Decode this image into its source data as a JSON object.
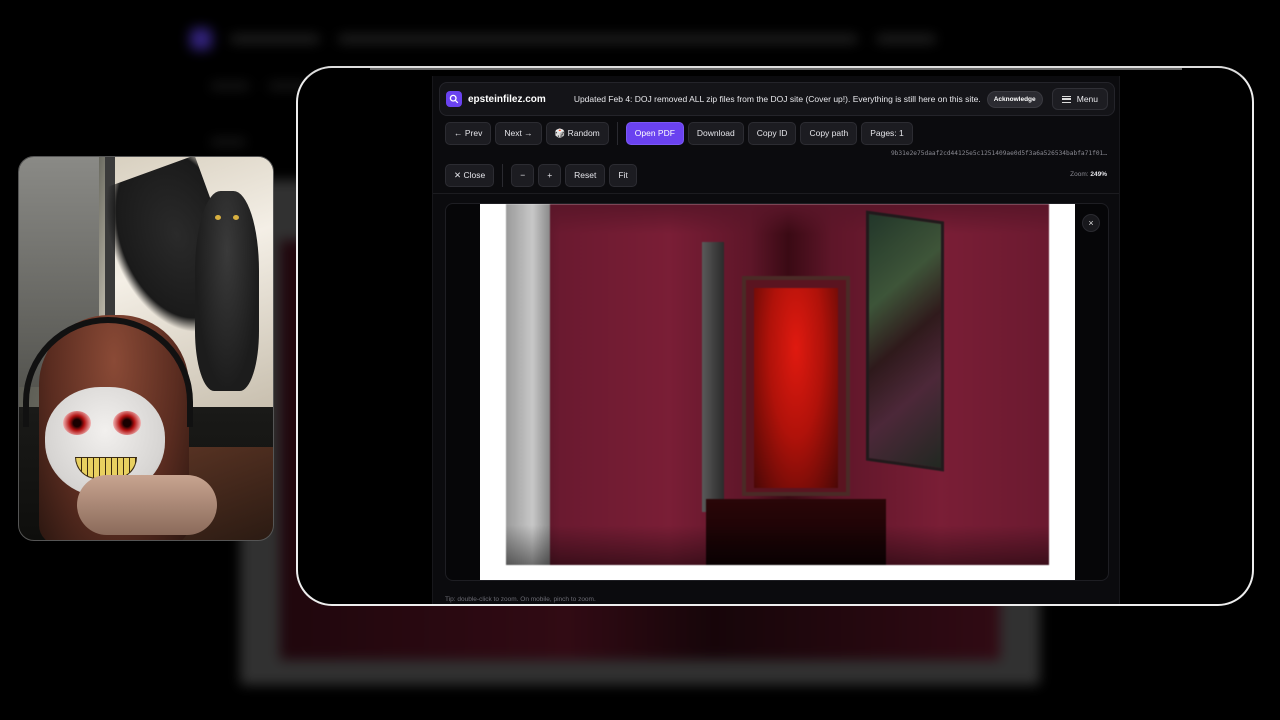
{
  "site": {
    "brand": "epsteinfilez.com",
    "notice": "Updated Feb 4: DOJ removed ALL zip files from the DOJ site (Cover up!). Everything is still here on this site.",
    "acknowledge_label": "Acknowledge",
    "menu_label": "Menu"
  },
  "toolbar": {
    "prev": "← Prev",
    "next": "Next →",
    "random": "🎲 Random",
    "open_pdf": "Open PDF",
    "download": "Download",
    "copy_id": "Copy ID",
    "copy_path": "Copy path",
    "pages": "Pages: 1",
    "hash": "9b31e2e75daaf2cd44125e5c1251409ae0d5f3a6a526534babfa71f01…"
  },
  "viewer_controls": {
    "close": "✕ Close",
    "zoom_out": "−",
    "zoom_in": "+",
    "reset": "Reset",
    "fit": "Fit",
    "zoom_label": "Zoom:",
    "zoom_value": "249%",
    "close_x": "×"
  },
  "tip": "Tip: double-click to zoom. On mobile, pinch to zoom.",
  "colors": {
    "accent": "#6a42f0",
    "background": "#0b0b0e",
    "wall": "#7a1e36",
    "end_door": "#e01a10"
  },
  "icons": {
    "logo": "search-icon",
    "menu": "hamburger-icon",
    "random": "dice-icon"
  }
}
